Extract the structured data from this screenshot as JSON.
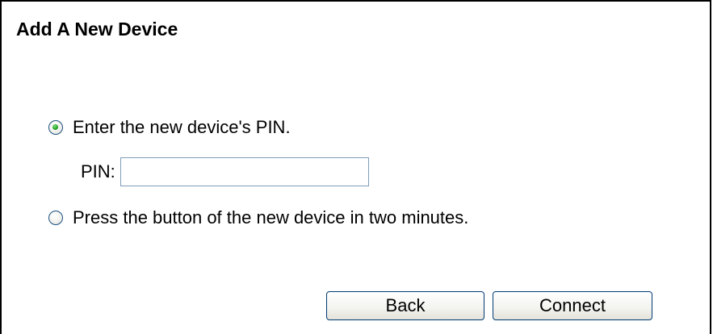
{
  "dialog": {
    "title": "Add A New Device"
  },
  "options": {
    "pin_option_label": "Enter the new device's PIN.",
    "pin_option_selected": true,
    "pin_label": "PIN:",
    "pin_value": "",
    "pbc_option_label": "Press the button of the new device in two minutes.",
    "pbc_option_selected": false
  },
  "buttons": {
    "back_label": "Back",
    "connect_label": "Connect"
  },
  "colors": {
    "radio_border": "#1c5180",
    "radio_dot": "#21a121",
    "input_border": "#7f9db9",
    "button_border": "#003c74"
  }
}
